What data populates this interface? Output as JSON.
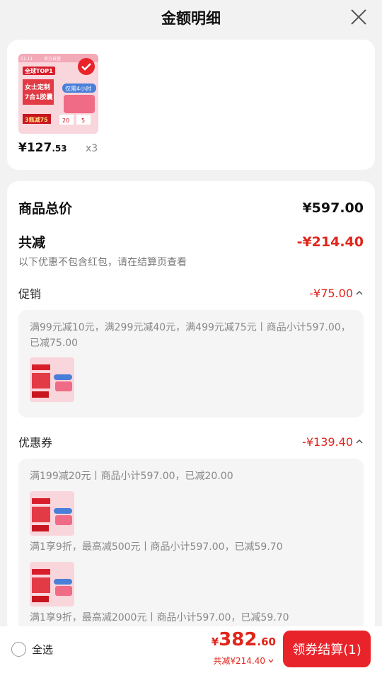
{
  "header": {
    "title": "金额明细"
  },
  "product": {
    "price_int": "¥127",
    "price_dec": ".53",
    "quantity": "x3",
    "image_text": {
      "badge": "全球TOP1",
      "line1": "女士定制",
      "line2": "7合1胶囊",
      "promo": "3瓶减75",
      "pill": "仅需4小时",
      "official": "官方自营",
      "tag_211": "11.11",
      "nums": [
        "20",
        "5"
      ]
    }
  },
  "summary": {
    "total_label": "商品总价",
    "total_value": "¥597.00",
    "discount_label": "共减",
    "discount_value": "-¥214.40",
    "note": "以下优惠不包含红包，请在结算页查看"
  },
  "promotion": {
    "label": "促销",
    "value": "-¥75.00",
    "rule": "满99元减10元，满299元减40元，满499元减75元丨商品小计597.00，已减75.00"
  },
  "coupon": {
    "label": "优惠券",
    "value": "-¥139.40",
    "items": [
      "满199减20元丨商品小计597.00，已减20.00",
      "满1享9折，最高减500元丨商品小计597.00，已减59.70",
      "满1享9折，最高减2000元丨商品小计597.00，已减59.70"
    ]
  },
  "footer": {
    "select_all": "全选",
    "total_sym": "¥",
    "total_int": "382",
    "total_dec": ".60",
    "total_sub": "共减¥214.40",
    "checkout": "领券结算(1)"
  },
  "colors": {
    "accent": "#e1251b",
    "button": "#e8242a"
  }
}
